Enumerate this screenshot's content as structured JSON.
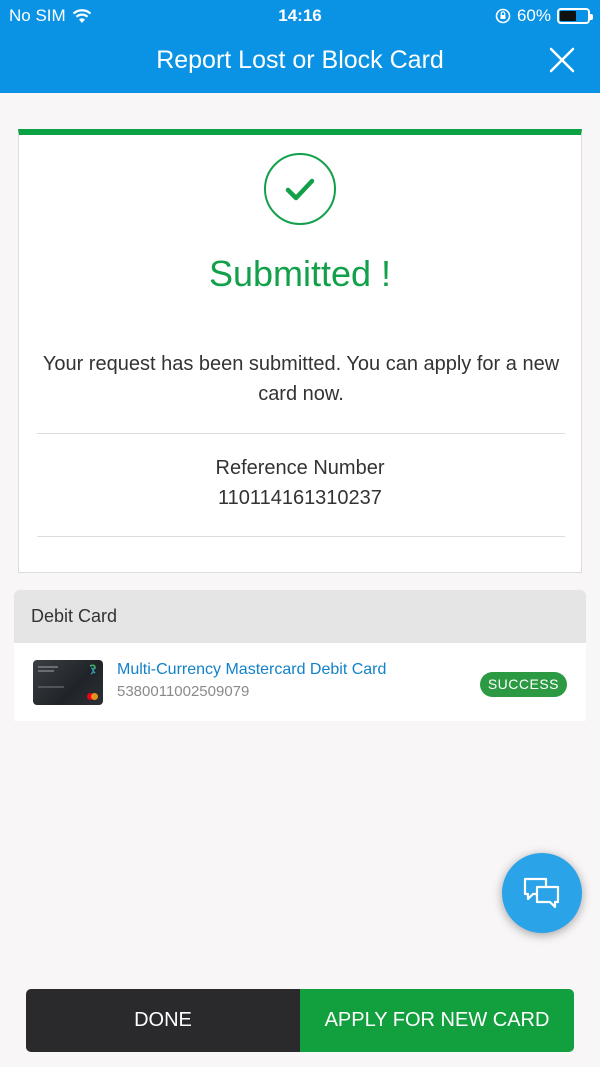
{
  "status_bar": {
    "carrier": "No SIM",
    "time": "14:16",
    "battery": "60%",
    "battery_level": 0.6
  },
  "header": {
    "title": "Report Lost or Block Card",
    "close_icon": "close-icon"
  },
  "result": {
    "icon": "checkmark-icon",
    "title": "Submitted !",
    "message": "Your request has been submitted. You can apply for a new card now.",
    "reference_label": "Reference Number",
    "reference_value": "110114161310237"
  },
  "cards_section": {
    "header": "Debit Card",
    "items": [
      {
        "name": "Multi-Currency Mastercard Debit Card",
        "number": "5380011002509079",
        "status": "SUCCESS"
      }
    ]
  },
  "chat": {
    "icon": "chat-bubbles-icon"
  },
  "actions": {
    "done_label": "DONE",
    "apply_label": "APPLY FOR NEW CARD"
  },
  "colors": {
    "header_bg": "#0a93e5",
    "success_green": "#12a04a",
    "badge_green": "#2c9a42",
    "link_blue": "#1282c8",
    "done_bg": "#2a2a2c",
    "chat_bg": "#2aa3e8"
  }
}
